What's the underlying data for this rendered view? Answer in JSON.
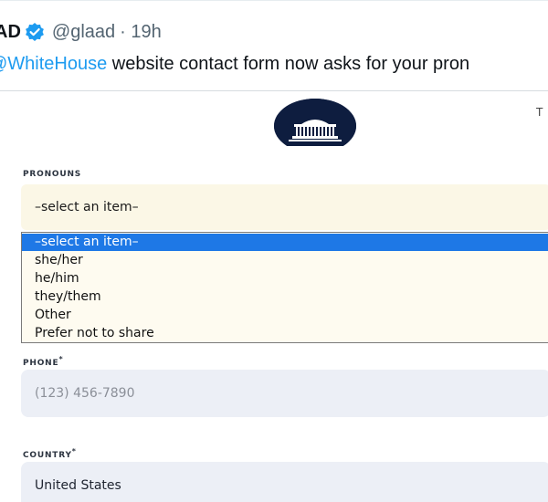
{
  "tweet": {
    "name": "AD",
    "handle": "@glaad",
    "time": "· 19h",
    "mention": "@WhiteHouse",
    "text_rest": " website contact form now asks for your pron"
  },
  "header": {
    "cut_text": "T"
  },
  "form": {
    "pronouns": {
      "label": "PRONOUNS",
      "selected": "–select an item–",
      "options": [
        "–select an item–",
        "she/her",
        "he/him",
        "they/them",
        "Other",
        "Prefer not to share"
      ]
    },
    "phone": {
      "label": "PHONE",
      "required_mark": "*",
      "placeholder": "(123) 456-7890"
    },
    "country": {
      "label": "COUNTRY",
      "required_mark": "*",
      "value": "United States"
    }
  },
  "colors": {
    "link": "#1d9bf0",
    "verified": "#1d9bf0",
    "dropdown_highlight": "#1e78e6",
    "select_bg": "#fbf7e6",
    "input_bg": "#eceff6",
    "logo_bg": "#0e1d3f"
  }
}
